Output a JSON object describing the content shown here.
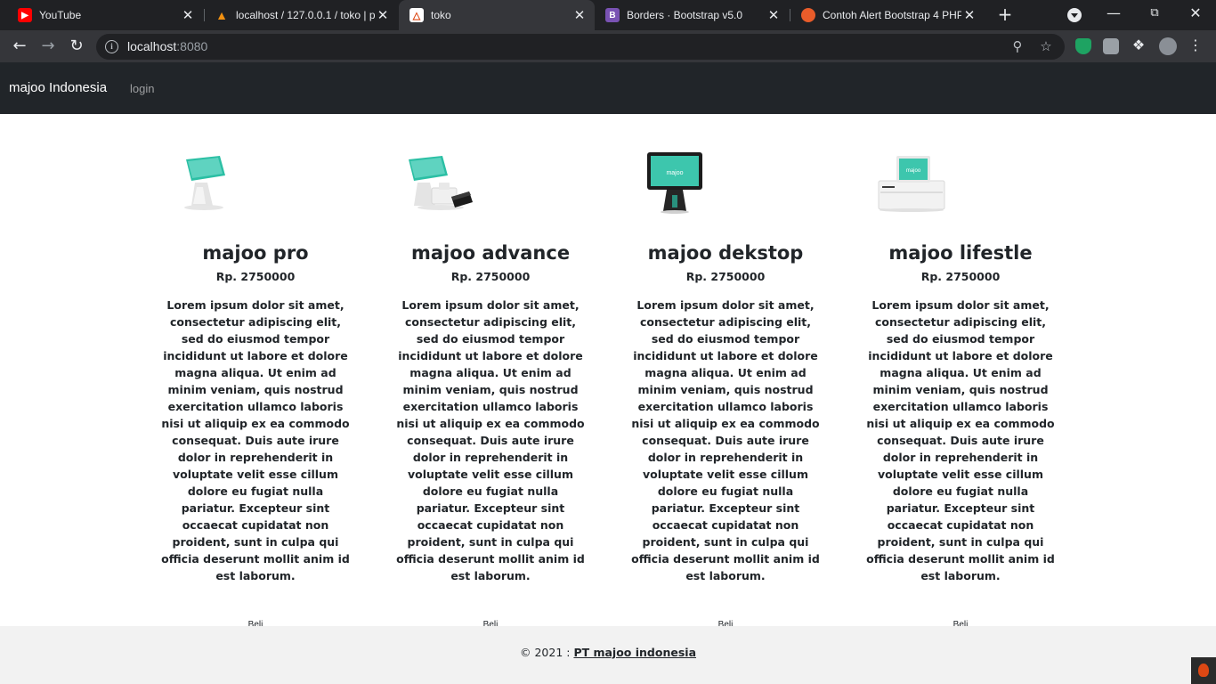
{
  "browser": {
    "tabs": [
      {
        "title": "YouTube",
        "icon": "youtube-icon",
        "color": "#ff0000",
        "active": false
      },
      {
        "title": "localhost / 127.0.0.1 / toko | p",
        "icon": "phpmyadmin-icon",
        "color": "#f29111",
        "active": false
      },
      {
        "title": "toko",
        "icon": "codeigniter-icon",
        "color": "#dd4814",
        "active": true
      },
      {
        "title": "Borders · Bootstrap v5.0",
        "icon": "bootstrap-icon",
        "color": "#7952b3",
        "active": false
      },
      {
        "title": "Contoh Alert Bootstrap 4 PHP",
        "icon": "site-icon",
        "color": "#e85c2a",
        "active": false
      }
    ],
    "url_host": "localhost",
    "url_port": ":8080"
  },
  "navbar": {
    "brand": "majoo Indonesia",
    "login": "login"
  },
  "products": [
    {
      "name": "majoo pro",
      "price": "Rp. 2750000",
      "description": "Lorem ipsum dolor sit amet, consectetur adipiscing elit, sed do eiusmod tempor incididunt ut labore et dolore magna aliqua. Ut enim ad minim veniam, quis nostrud exercitation ullamco laboris nisi ut aliquip ex ea commodo consequat. Duis aute irure dolor in reprehenderit in voluptate velit esse cillum dolore eu fugiat nulla pariatur. Excepteur sint occaecat cupidatat non proident, sunt in culpa qui officia deserunt mollit anim id est laborum.",
      "buy": "Beli",
      "image": "majoo-pro-device-image"
    },
    {
      "name": "majoo advance",
      "price": "Rp. 2750000",
      "description": "Lorem ipsum dolor sit amet, consectetur adipiscing elit, sed do eiusmod tempor incididunt ut labore et dolore magna aliqua. Ut enim ad minim veniam, quis nostrud exercitation ullamco laboris nisi ut aliquip ex ea commodo consequat. Duis aute irure dolor in reprehenderit in voluptate velit esse cillum dolore eu fugiat nulla pariatur. Excepteur sint occaecat cupidatat non proident, sunt in culpa qui officia deserunt mollit anim id est laborum.",
      "buy": "Beli",
      "image": "majoo-advance-device-image"
    },
    {
      "name": "majoo dekstop",
      "price": "Rp. 2750000",
      "description": "Lorem ipsum dolor sit amet, consectetur adipiscing elit, sed do eiusmod tempor incididunt ut labore et dolore magna aliqua. Ut enim ad minim veniam, quis nostrud exercitation ullamco laboris nisi ut aliquip ex ea commodo consequat. Duis aute irure dolor in reprehenderit in voluptate velit esse cillum dolore eu fugiat nulla pariatur. Excepteur sint occaecat cupidatat non proident, sunt in culpa qui officia deserunt mollit anim id est laborum.",
      "buy": "Beli",
      "image": "majoo-desktop-device-image"
    },
    {
      "name": "majoo lifestle",
      "price": "Rp. 2750000",
      "description": "Lorem ipsum dolor sit amet, consectetur adipiscing elit, sed do eiusmod tempor incididunt ut labore et dolore magna aliqua. Ut enim ad minim veniam, quis nostrud exercitation ullamco laboris nisi ut aliquip ex ea commodo consequat. Duis aute irure dolor in reprehenderit in voluptate velit esse cillum dolore eu fugiat nulla pariatur. Excepteur sint occaecat cupidatat non proident, sunt in culpa qui officia deserunt mollit anim id est laborum.",
      "buy": "Beli",
      "image": "majoo-lifestyle-device-image"
    }
  ],
  "footer": {
    "copyright": "© 2021 : ",
    "company": "PT majoo indonesia"
  },
  "colors": {
    "navbar_bg": "#212529",
    "footer_bg": "#f2f2f2",
    "device_accent": "#2bbfa4"
  }
}
